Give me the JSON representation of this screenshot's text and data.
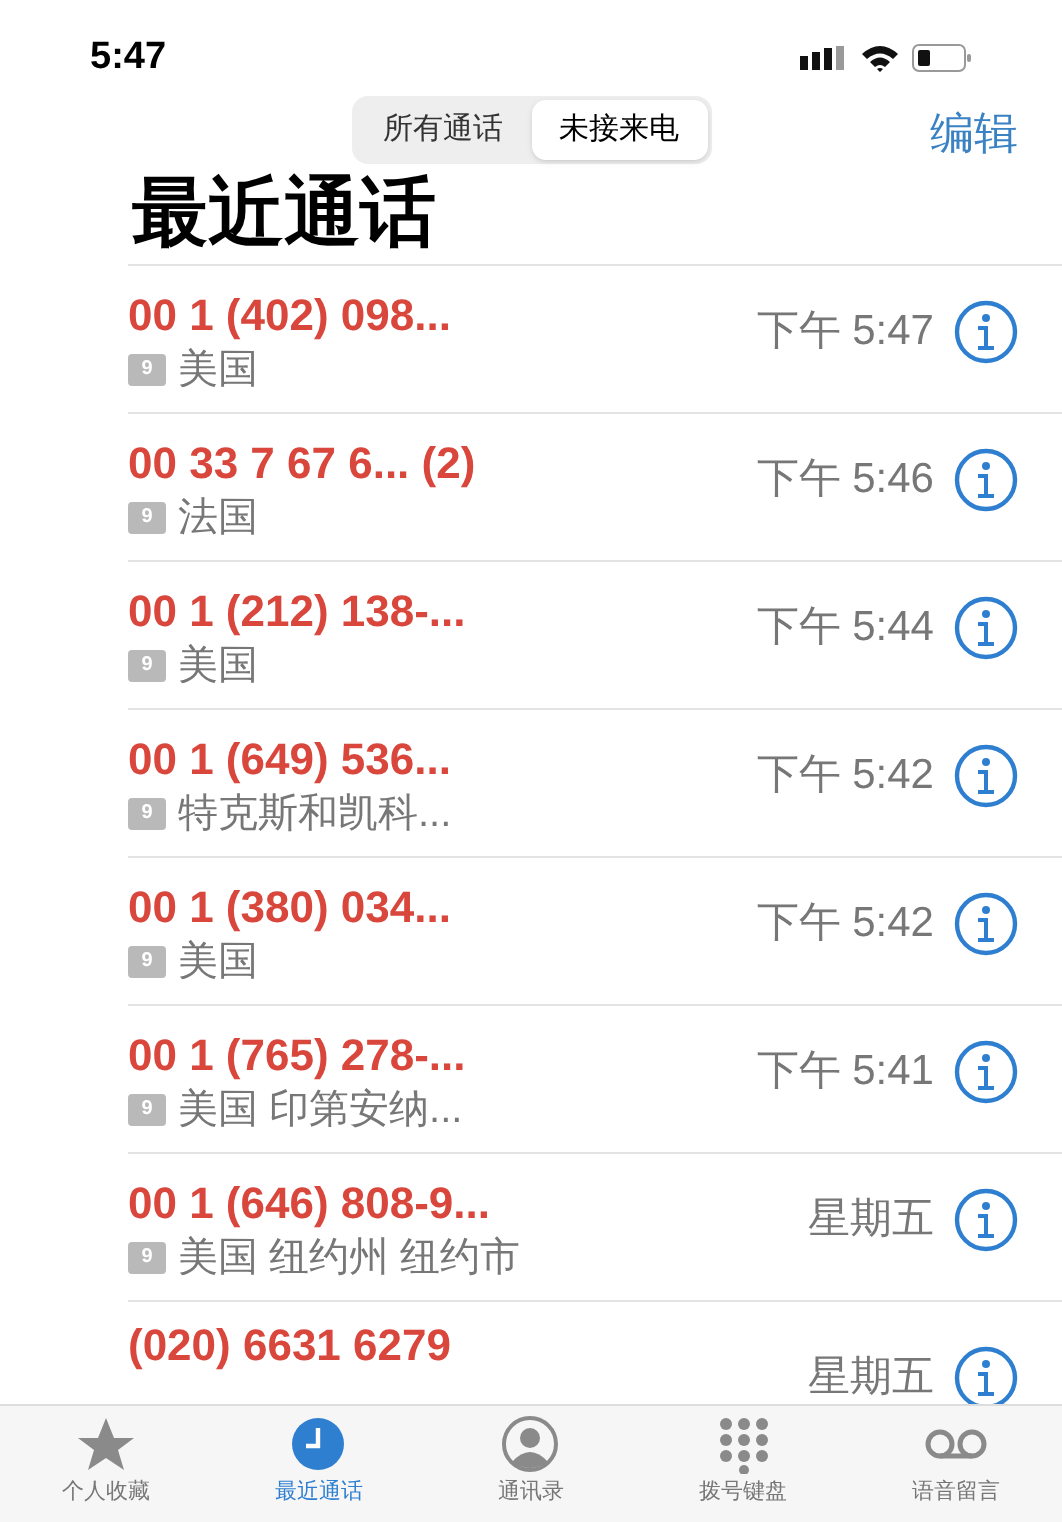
{
  "status_bar": {
    "time": "5:47"
  },
  "segments": [
    {
      "label": "所有通话",
      "selected": false
    },
    {
      "label": "未接来电",
      "selected": true
    }
  ],
  "edit_button": "编辑",
  "title": "最近通话",
  "calls": [
    {
      "number": "00 1 (402) 098...",
      "missed": true,
      "badge": "9",
      "location": "美国",
      "time": "下午 5:47"
    },
    {
      "number": "00 33 7 67 6... (2)",
      "missed": true,
      "badge": "9",
      "location": "法国",
      "time": "下午 5:46"
    },
    {
      "number": "00 1 (212) 138-...",
      "missed": true,
      "badge": "9",
      "location": "美国",
      "time": "下午 5:44"
    },
    {
      "number": "00 1 (649) 536...",
      "missed": true,
      "badge": "9",
      "location": "特克斯和凯科...",
      "time": "下午 5:42"
    },
    {
      "number": "00 1 (380) 034...",
      "missed": true,
      "badge": "9",
      "location": "美国",
      "time": "下午 5:42"
    },
    {
      "number": "00 1 (765) 278-...",
      "missed": true,
      "badge": "9",
      "location": "美国 印第安纳...",
      "time": "下午 5:41"
    },
    {
      "number": "00 1 (646) 808-9...",
      "missed": true,
      "badge": "9",
      "location": "美国 纽约州 纽约市",
      "time": "星期五"
    },
    {
      "number": "(020) 6631 6279",
      "missed": true,
      "time": "星期五"
    }
  ],
  "tab_bar": [
    {
      "kind": "favorites",
      "label": "个人收藏",
      "selected": false
    },
    {
      "kind": "recents",
      "label": "最近通话",
      "selected": true
    },
    {
      "kind": "contacts",
      "label": "通讯录",
      "selected": false
    },
    {
      "kind": "keypad",
      "label": "拨号键盘",
      "selected": false
    },
    {
      "kind": "voicemail",
      "label": "语音留言",
      "selected": false
    }
  ]
}
